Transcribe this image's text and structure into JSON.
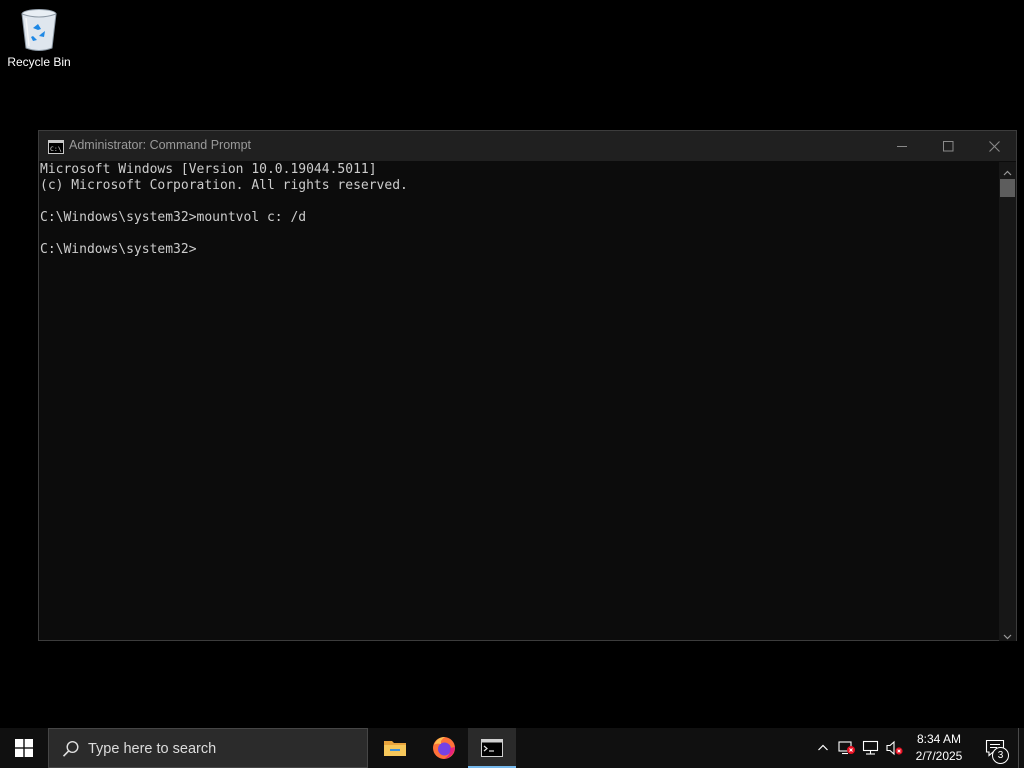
{
  "desktop": {
    "icons": [
      {
        "label": "Recycle Bin",
        "icon": "recycle-bin-icon"
      }
    ]
  },
  "window": {
    "title": "Administrator: Command Prompt",
    "icon": "cmd-icon",
    "console_lines": [
      "Microsoft Windows [Version 10.0.19044.5011]",
      "(c) Microsoft Corporation. All rights reserved.",
      "",
      "C:\\Windows\\system32>mountvol c: /d",
      "",
      "C:\\Windows\\system32>"
    ]
  },
  "taskbar": {
    "search_placeholder": "Type here to search",
    "pinned_apps": [
      "file-explorer-icon",
      "firefox-icon",
      "cmd-icon"
    ],
    "clock": {
      "time": "8:34 AM",
      "date": "2/7/2025"
    },
    "notification_count": "3"
  },
  "colors": {
    "console_bg": "#0c0c0c",
    "console_text": "#cccccc",
    "titlebar": "#202020",
    "taskbar": "#101010",
    "accent": "#76b9ed"
  }
}
